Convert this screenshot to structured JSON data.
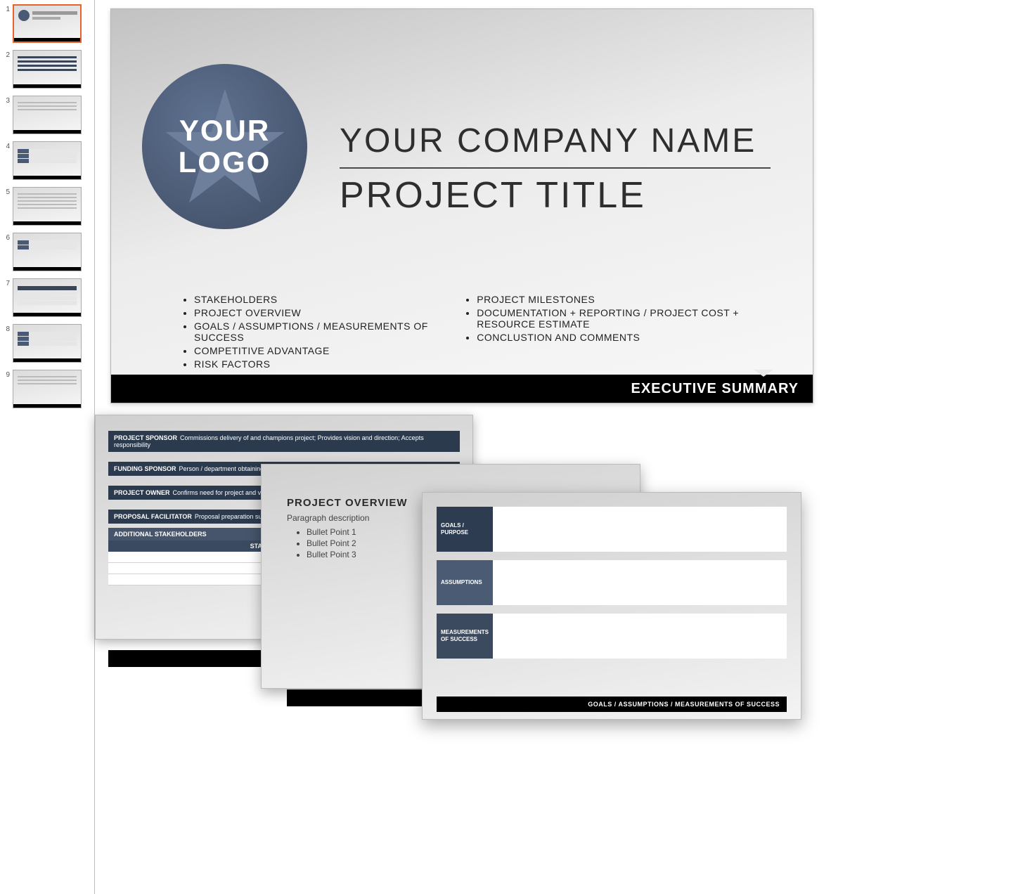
{
  "thumbnails": [
    {
      "num": "1",
      "selected": true
    },
    {
      "num": "2",
      "selected": false
    },
    {
      "num": "3",
      "selected": false
    },
    {
      "num": "4",
      "selected": false
    },
    {
      "num": "5",
      "selected": false
    },
    {
      "num": "6",
      "selected": false
    },
    {
      "num": "7",
      "selected": false
    },
    {
      "num": "8",
      "selected": false
    },
    {
      "num": "9",
      "selected": false
    }
  ],
  "slide1": {
    "logo_line1": "YOUR",
    "logo_line2": "LOGO",
    "company": "YOUR COMPANY NAME",
    "project": "PROJECT TITLE",
    "left_bullets": [
      "STAKEHOLDERS",
      "PROJECT OVERVIEW",
      "GOALS / ASSUMPTIONS / MEASUREMENTS OF SUCCESS",
      "COMPETITIVE ADVANTAGE",
      "RISK FACTORS"
    ],
    "right_bullets": [
      "PROJECT MILESTONES",
      "DOCUMENTATION + REPORTING / PROJECT COST + RESOURCE ESTIMATE",
      "CONCLUSTION AND COMMENTS"
    ],
    "footer": "EXECUTIVE SUMMARY"
  },
  "stakeholders": {
    "rows": [
      {
        "label": "PROJECT SPONSOR",
        "desc": "Commissions delivery of and champions project; Provides vision and direction; Accepts responsibility"
      },
      {
        "label": "FUNDING SPONSOR",
        "desc": "Person / department obtaining budget required"
      },
      {
        "label": "PROJECT OWNER",
        "desc": "Confirms need for project and validates objectives"
      },
      {
        "label": "PROPOSAL FACILITATOR",
        "desc": "Proposal preparation support"
      }
    ],
    "subhead": "ADDITIONAL STAKEHOLDERS",
    "col": "STAKEHOLDER NAME"
  },
  "overview": {
    "title": "PROJECT OVERVIEW",
    "para": "Paragraph description",
    "bullets": [
      "Bullet Point 1",
      "Bullet Point 2",
      "Bullet Point 3"
    ]
  },
  "goals": {
    "rows": [
      "GOALS / PURPOSE",
      "ASSUMPTIONS",
      "MEASUREMENTS OF SUCCESS"
    ],
    "footer": "GOALS / ASSUMPTIONS / MEASUREMENTS OF SUCCESS"
  }
}
